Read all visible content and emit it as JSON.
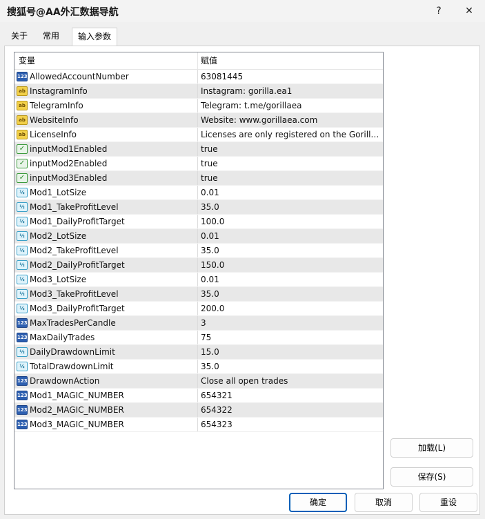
{
  "window": {
    "title": "搜狐号@AA外汇数据导航",
    "help_label": "?",
    "close_label": "✕"
  },
  "tabs": [
    {
      "label": "关于"
    },
    {
      "label": "常用"
    },
    {
      "label": "输入参数"
    }
  ],
  "grid": {
    "header_name": "变量",
    "header_value": "赋值",
    "rows": [
      {
        "name": "AllowedAccountNumber",
        "value": "63081445",
        "icon": "int-icon",
        "badge": "123"
      },
      {
        "name": "InstagramInfo",
        "value": "Instagram: gorilla.ea1",
        "icon": "string-icon",
        "badge": "ab"
      },
      {
        "name": "TelegramInfo",
        "value": "Telegram: t.me/gorillaea",
        "icon": "string-icon",
        "badge": "ab"
      },
      {
        "name": "WebsiteInfo",
        "value": "Website: www.gorillaea.com",
        "icon": "string-icon",
        "badge": "ab"
      },
      {
        "name": "LicenseInfo",
        "value": "Licenses are only registered on the Gorilla ...",
        "icon": "string-icon",
        "badge": "ab"
      },
      {
        "name": "inputMod1Enabled",
        "value": "true",
        "icon": "bool-icon",
        "badge": "✓"
      },
      {
        "name": "inputMod2Enabled",
        "value": "true",
        "icon": "bool-icon",
        "badge": "✓"
      },
      {
        "name": "inputMod3Enabled",
        "value": "true",
        "icon": "bool-icon",
        "badge": "✓"
      },
      {
        "name": "Mod1_LotSize",
        "value": "0.01",
        "icon": "double-icon",
        "badge": "½"
      },
      {
        "name": "Mod1_TakeProfitLevel",
        "value": "35.0",
        "icon": "double-icon",
        "badge": "½"
      },
      {
        "name": "Mod1_DailyProfitTarget",
        "value": "100.0",
        "icon": "double-icon",
        "badge": "½"
      },
      {
        "name": "Mod2_LotSize",
        "value": "0.01",
        "icon": "double-icon",
        "badge": "½"
      },
      {
        "name": "Mod2_TakeProfitLevel",
        "value": "35.0",
        "icon": "double-icon",
        "badge": "½"
      },
      {
        "name": "Mod2_DailyProfitTarget",
        "value": "150.0",
        "icon": "double-icon",
        "badge": "½"
      },
      {
        "name": "Mod3_LotSize",
        "value": "0.01",
        "icon": "double-icon",
        "badge": "½"
      },
      {
        "name": "Mod3_TakeProfitLevel",
        "value": "35.0",
        "icon": "double-icon",
        "badge": "½"
      },
      {
        "name": "Mod3_DailyProfitTarget",
        "value": "200.0",
        "icon": "double-icon",
        "badge": "½"
      },
      {
        "name": "MaxTradesPerCandle",
        "value": "3",
        "icon": "int-icon",
        "badge": "123"
      },
      {
        "name": "MaxDailyTrades",
        "value": "75",
        "icon": "int-icon",
        "badge": "123"
      },
      {
        "name": "DailyDrawdownLimit",
        "value": "15.0",
        "icon": "double-icon",
        "badge": "½"
      },
      {
        "name": "TotalDrawdownLimit",
        "value": "35.0",
        "icon": "double-icon",
        "badge": "½"
      },
      {
        "name": "DrawdownAction",
        "value": "Close all open trades",
        "icon": "int-icon",
        "badge": "123"
      },
      {
        "name": "Mod1_MAGIC_NUMBER",
        "value": "654321",
        "icon": "int-icon",
        "badge": "123"
      },
      {
        "name": "Mod2_MAGIC_NUMBER",
        "value": "654322",
        "icon": "int-icon",
        "badge": "123"
      },
      {
        "name": "Mod3_MAGIC_NUMBER",
        "value": "654323",
        "icon": "int-icon",
        "badge": "123"
      }
    ]
  },
  "buttons": {
    "load": "加载(L)",
    "save": "保存(S)",
    "ok": "确定",
    "cancel": "取消",
    "reset": "重设"
  }
}
